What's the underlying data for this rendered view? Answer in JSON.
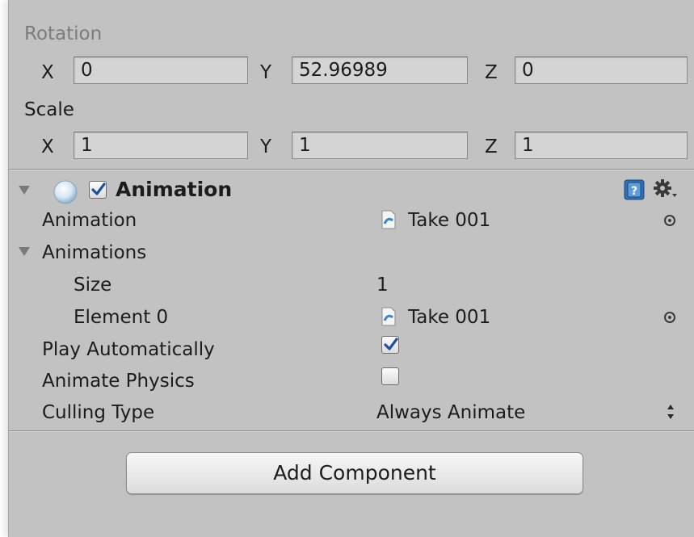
{
  "transform": {
    "rotation": {
      "label": "Rotation",
      "x_label": "X",
      "x": "0",
      "y_label": "Y",
      "y": "52.96989",
      "z_label": "Z",
      "z": "0"
    },
    "scale": {
      "label": "Scale",
      "x_label": "X",
      "x": "1",
      "y_label": "Y",
      "y": "1",
      "z_label": "Z",
      "z": "1"
    }
  },
  "component": {
    "title": "Animation",
    "enabled": true,
    "icons": [
      "foldout-arrow-icon",
      "animation-component-icon",
      "help-book-icon",
      "gear-icon"
    ],
    "properties": {
      "animation_label": "Animation",
      "animation_value": "Take 001",
      "animations_label": "Animations",
      "size_label": "Size",
      "size_value": "1",
      "element0_label": "Element 0",
      "element0_value": "Take 001",
      "play_auto_label": "Play Automatically",
      "play_auto_checked": true,
      "animate_physics_label": "Animate Physics",
      "animate_physics_checked": false,
      "culling_label": "Culling Type",
      "culling_value": "Always Animate"
    }
  },
  "add_component_label": "Add Component",
  "colors": {
    "panel": "#c2c2c2",
    "field": "#d4d4d4",
    "checkmark": "#1f4fa0"
  }
}
